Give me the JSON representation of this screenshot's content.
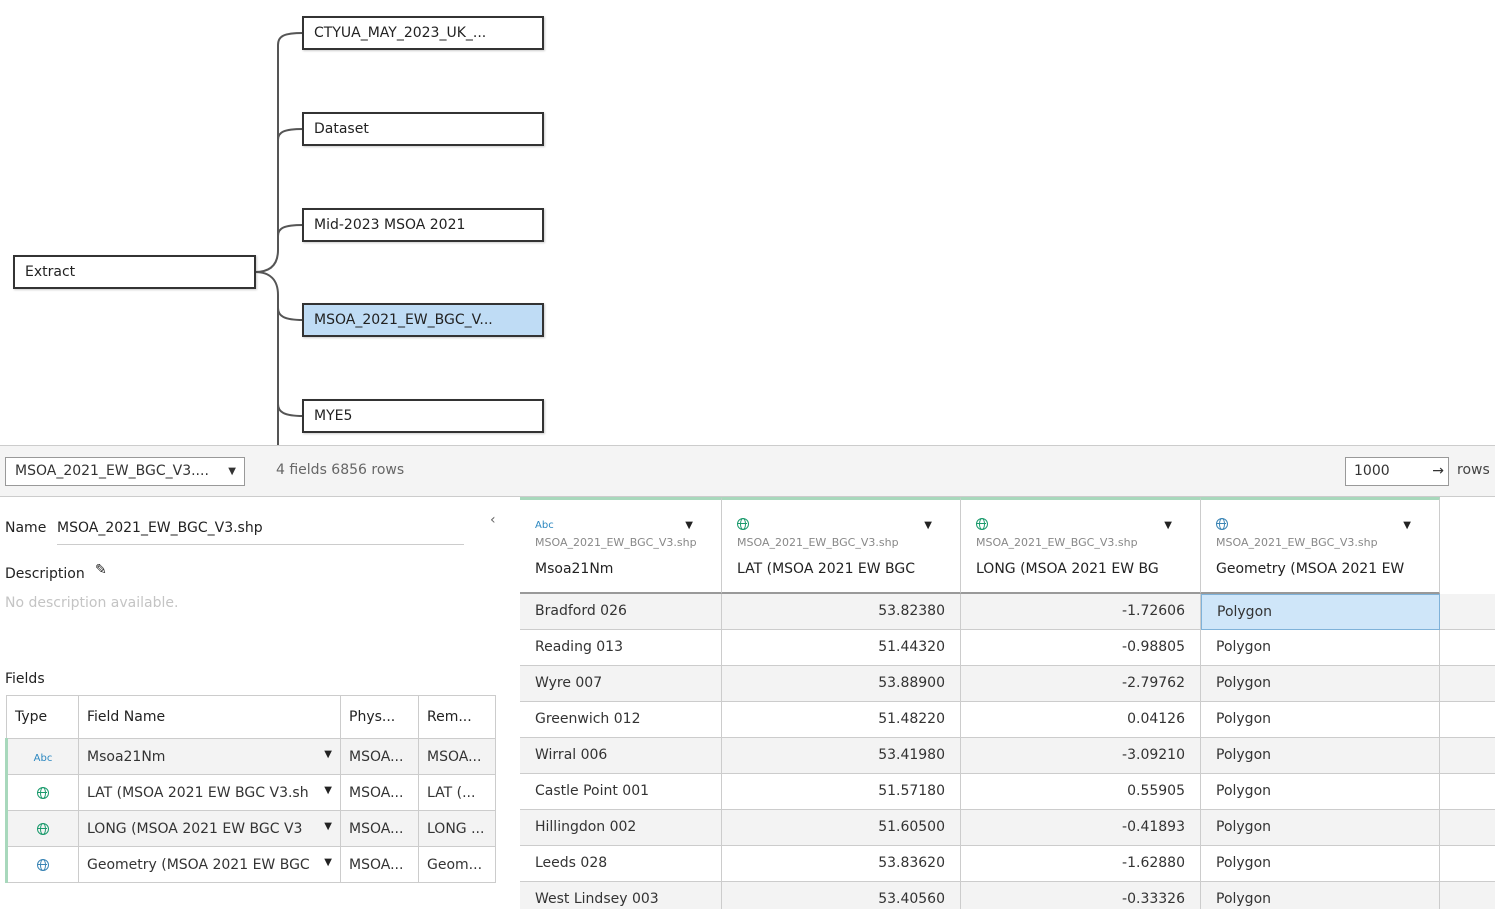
{
  "flow": {
    "root": "Extract",
    "nodes": [
      "CTYUA_MAY_2023_UK_...",
      "Dataset",
      "Mid-2023 MSOA 2021",
      "MSOA_2021_EW_BGC_V...",
      "MYE5"
    ],
    "selected_index": 3
  },
  "toolbar": {
    "table_select": "MSOA_2021_EW_BGC_V3....",
    "info": "4 fields 6856 rows",
    "rows_value": "1000",
    "rows_label": "rows"
  },
  "details": {
    "name_label": "Name",
    "name_value": "MSOA_2021_EW_BGC_V3.shp",
    "description_label": "Description",
    "description_placeholder": "No description available.",
    "fields_label": "Fields"
  },
  "fields": {
    "headers": [
      "Type",
      "Field Name",
      "Phys...",
      "Rem..."
    ],
    "rows": [
      {
        "type": "Abc",
        "name": "Msoa21Nm",
        "phys": "MSOA...",
        "rem": "MSOA..."
      },
      {
        "type": "globe",
        "name": "LAT (MSOA 2021 EW BGC V3.sh",
        "phys": "MSOA...",
        "rem": "LAT (..."
      },
      {
        "type": "globe",
        "name": "LONG (MSOA 2021 EW BGC V3",
        "phys": "MSOA...",
        "rem": "LONG ..."
      },
      {
        "type": "geo",
        "name": "Geometry (MSOA 2021 EW BGC",
        "phys": "MSOA...",
        "rem": "Geom..."
      }
    ]
  },
  "grid": {
    "columns": [
      {
        "type": "Abc",
        "source": "MSOA_2021_EW_BGC_V3.shp",
        "name": "Msoa21Nm"
      },
      {
        "type": "globe",
        "source": "MSOA_2021_EW_BGC_V3.shp",
        "name": "LAT (MSOA 2021 EW BGC"
      },
      {
        "type": "globe",
        "source": "MSOA_2021_EW_BGC_V3.shp",
        "name": "LONG (MSOA 2021 EW BG"
      },
      {
        "type": "geo",
        "source": "MSOA_2021_EW_BGC_V3.shp",
        "name": "Geometry (MSOA 2021 EW"
      }
    ],
    "rows": [
      [
        "Bradford 026",
        "53.82380",
        "-1.72606",
        "Polygon"
      ],
      [
        "Reading 013",
        "51.44320",
        "-0.98805",
        "Polygon"
      ],
      [
        "Wyre 007",
        "53.88900",
        "-2.79762",
        "Polygon"
      ],
      [
        "Greenwich 012",
        "51.48220",
        "0.04126",
        "Polygon"
      ],
      [
        "Wirral 006",
        "53.41980",
        "-3.09210",
        "Polygon"
      ],
      [
        "Castle Point 001",
        "51.57180",
        "0.55905",
        "Polygon"
      ],
      [
        "Hillingdon 002",
        "51.60500",
        "-0.41893",
        "Polygon"
      ],
      [
        "Leeds 028",
        "53.83620",
        "-1.62880",
        "Polygon"
      ],
      [
        "West Lindsey 003",
        "53.40560",
        "-0.33326",
        "Polygon"
      ]
    ]
  }
}
